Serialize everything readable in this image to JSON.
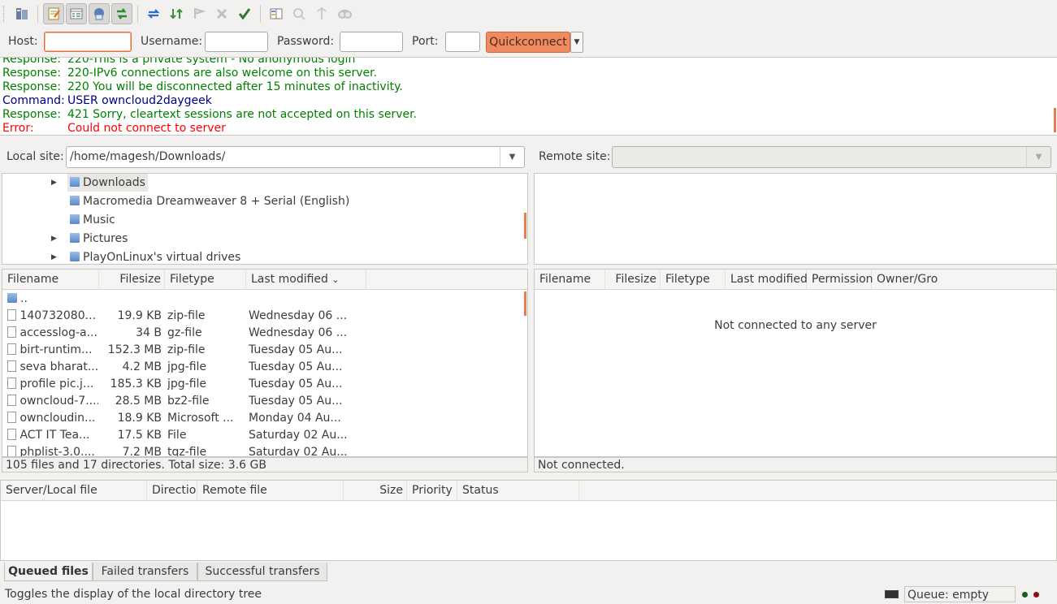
{
  "toolbar": {
    "buttons": [
      {
        "name": "site-manager-icon"
      },
      {
        "name": "toggle-message-log-icon"
      },
      {
        "name": "toggle-local-tree-icon"
      },
      {
        "name": "toggle-remote-tree-icon"
      },
      {
        "name": "toggle-transfer-queue-icon"
      },
      {
        "name": "refresh-icon"
      },
      {
        "name": "process-queue-icon"
      },
      {
        "name": "cancel-operation-icon"
      },
      {
        "name": "disconnect-icon"
      },
      {
        "name": "reconnect-icon"
      },
      {
        "name": "directory-filters-icon"
      },
      {
        "name": "directory-comparison-icon"
      },
      {
        "name": "synchronized-browsing-icon"
      },
      {
        "name": "search-remote-files-icon"
      }
    ]
  },
  "quickconnect": {
    "host_label": "Host:",
    "host_value": "",
    "username_label": "Username:",
    "username_value": "",
    "password_label": "Password:",
    "password_value": "",
    "port_label": "Port:",
    "port_value": "",
    "button_label": "Quickconnect"
  },
  "log": [
    {
      "type": "Response:",
      "text": "220-This is a private system - No anonymous login",
      "color": "#008000"
    },
    {
      "type": "Response:",
      "text": "220-IPv6 connections are also welcome on this server.",
      "color": "#008000"
    },
    {
      "type": "Response:",
      "text": "220 You will be disconnected after 15 minutes of inactivity.",
      "color": "#008000"
    },
    {
      "type": "Command:",
      "text": "USER owncloud2daygeek",
      "color": "#000080"
    },
    {
      "type": "Response:",
      "text": "421 Sorry, cleartext sessions are not accepted on this server.",
      "color": "#008000"
    },
    {
      "type": "Error:",
      "text": "Could not connect to server",
      "color": "#ff0000"
    }
  ],
  "local": {
    "site_label": "Local site:",
    "path": "/home/magesh/Downloads/",
    "tree": [
      {
        "label": "Downloads",
        "expander": true,
        "selected": true
      },
      {
        "label": "Macromedia Dreamweaver 8 + Serial (English)",
        "expander": false,
        "selected": false
      },
      {
        "label": "Music",
        "expander": false,
        "selected": false
      },
      {
        "label": "Pictures",
        "expander": true,
        "selected": false
      },
      {
        "label": "PlayOnLinux's virtual drives",
        "expander": true,
        "selected": false
      }
    ],
    "columns": {
      "filename": "Filename",
      "filesize": "Filesize",
      "filetype": "Filetype",
      "modified": "Last modified"
    },
    "parent_dir": "..",
    "files": [
      {
        "name": "140732080...",
        "size": "19.9 KB",
        "type": "zip-file",
        "modified": "Wednesday 06 ..."
      },
      {
        "name": "accesslog-a...",
        "size": "34 B",
        "type": "gz-file",
        "modified": "Wednesday 06 ..."
      },
      {
        "name": "birt-runtim...",
        "size": "152.3 MB",
        "type": "zip-file",
        "modified": "Tuesday 05 Au..."
      },
      {
        "name": "seva bharat...",
        "size": "4.2 MB",
        "type": "jpg-file",
        "modified": "Tuesday 05 Au..."
      },
      {
        "name": "profile pic.j...",
        "size": "185.3 KB",
        "type": "jpg-file",
        "modified": "Tuesday 05 Au..."
      },
      {
        "name": "owncloud-7....",
        "size": "28.5 MB",
        "type": "bz2-file",
        "modified": "Tuesday 05 Au..."
      },
      {
        "name": "owncloudin...",
        "size": "18.9 KB",
        "type": "Microsoft ...",
        "modified": "Monday 04 Au..."
      },
      {
        "name": "ACT IT Tea...",
        "size": "17.5 KB",
        "type": "File",
        "modified": "Saturday 02 Au..."
      },
      {
        "name": "phplist-3.0....",
        "size": "7.2 MB",
        "type": "tgz-file",
        "modified": "Saturday 02 Au..."
      }
    ],
    "status": "105 files and 17 directories. Total size: 3.6 GB"
  },
  "remote": {
    "site_label": "Remote site:",
    "path": "",
    "columns": {
      "filename": "Filename",
      "filesize": "Filesize",
      "filetype": "Filetype",
      "modified": "Last modified",
      "permission": "Permission",
      "owner": "Owner/Gro"
    },
    "empty_message": "Not connected to any server",
    "status": "Not connected."
  },
  "queue": {
    "columns": {
      "server": "Server/Local file",
      "direction": "Directio",
      "remote": "Remote file",
      "size": "Size",
      "priority": "Priority",
      "status": "Status"
    },
    "tabs": [
      "Queued files",
      "Failed transfers",
      "Successful transfers"
    ]
  },
  "statusbar": {
    "message": "Toggles the display of the local directory tree",
    "queue": "Queue: empty"
  },
  "colors": {
    "accent": "#f08b5f",
    "scroll_thumb": "#e57f4e"
  }
}
